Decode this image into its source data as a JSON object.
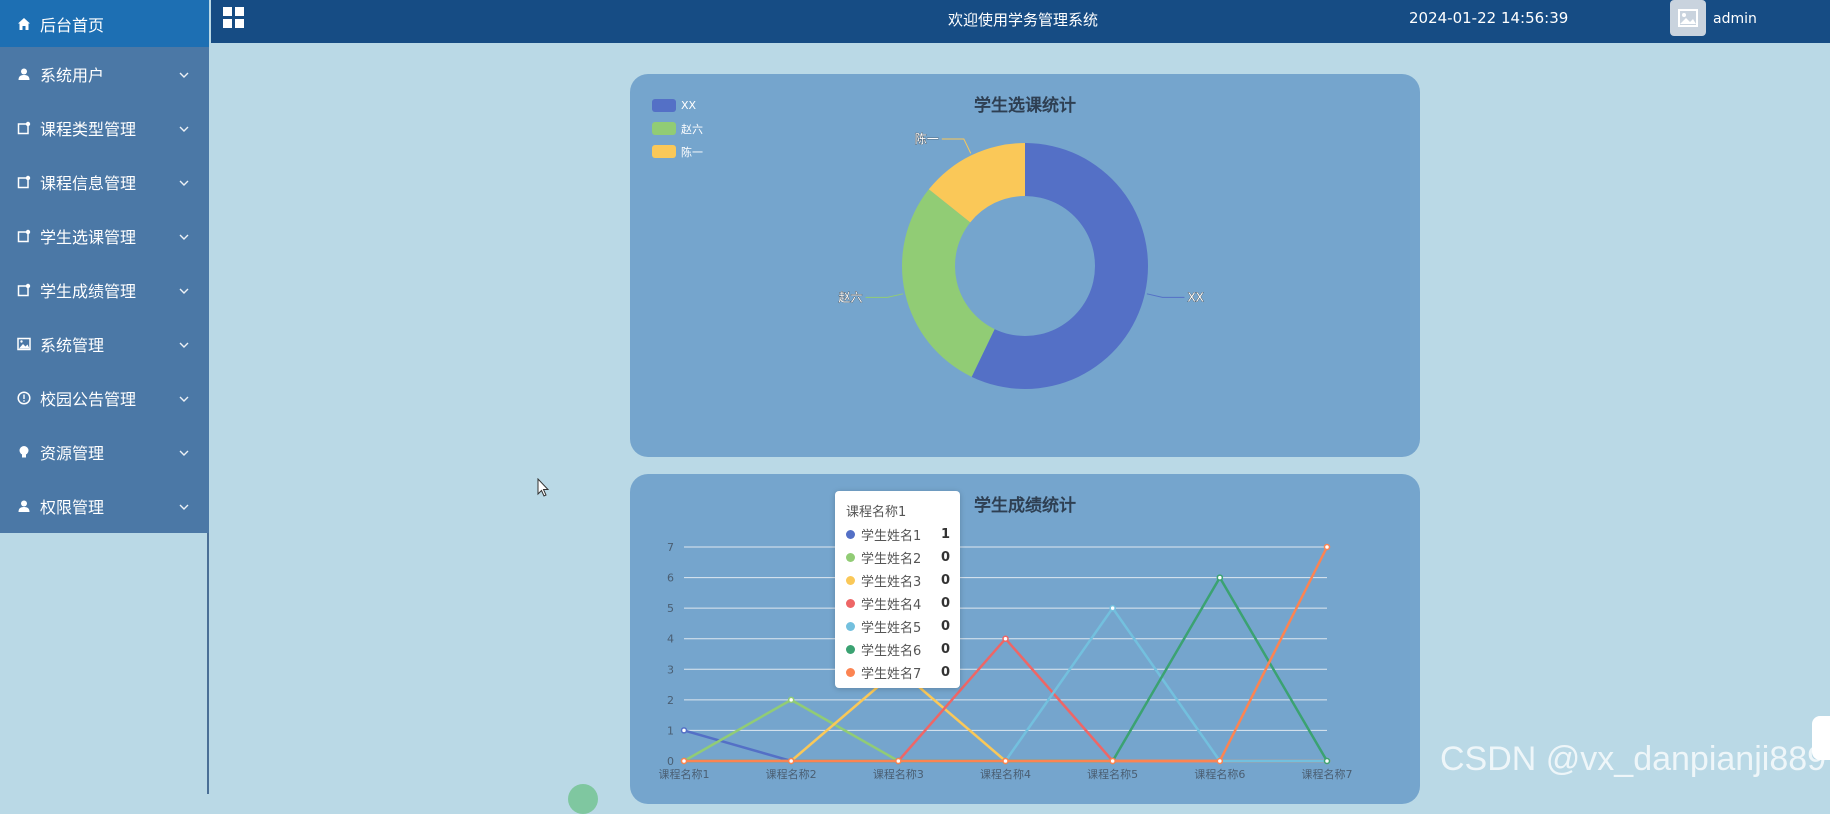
{
  "sidebar": {
    "items": [
      {
        "label": "后台首页",
        "icon": "home-icon",
        "active": true
      },
      {
        "label": "系统用户",
        "icon": "user-icon"
      },
      {
        "label": "课程类型管理",
        "icon": "edit-icon"
      },
      {
        "label": "课程信息管理",
        "icon": "edit-icon"
      },
      {
        "label": "学生选课管理",
        "icon": "edit-icon"
      },
      {
        "label": "学生成绩管理",
        "icon": "edit-icon"
      },
      {
        "label": "系统管理",
        "icon": "image-icon"
      },
      {
        "label": "校园公告管理",
        "icon": "info-icon"
      },
      {
        "label": "资源管理",
        "icon": "bulb-icon"
      },
      {
        "label": "权限管理",
        "icon": "user-icon"
      }
    ]
  },
  "header": {
    "title": "欢迎使用学务管理系统",
    "datetime": "2024-01-22 14:56:39",
    "username": "admin"
  },
  "colors": {
    "series": [
      "#5470c6",
      "#91cc75",
      "#fac858",
      "#ee6666",
      "#73c0de",
      "#3ba272",
      "#fc8452"
    ]
  },
  "chart_data": [
    {
      "type": "pie",
      "title": "学生选课统计",
      "categories": [
        "XX",
        "赵六",
        "陈一"
      ],
      "values": [
        4,
        2,
        1
      ],
      "legend": "top-left",
      "donut": true
    },
    {
      "type": "line",
      "title": "学生成绩统计",
      "x": [
        "课程名称1",
        "课程名称2",
        "课程名称3",
        "课程名称4",
        "课程名称5",
        "课程名称6",
        "课程名称7"
      ],
      "ylim": [
        0,
        7
      ],
      "yticks": [
        0,
        1,
        2,
        3,
        4,
        5,
        6,
        7
      ],
      "series": [
        {
          "name": "学生姓名1",
          "values": [
            1,
            0,
            0,
            0,
            0,
            0,
            0
          ]
        },
        {
          "name": "学生姓名2",
          "values": [
            0,
            2,
            0,
            0,
            0,
            0,
            0
          ]
        },
        {
          "name": "学生姓名3",
          "values": [
            0,
            0,
            3,
            0,
            0,
            0,
            0
          ]
        },
        {
          "name": "学生姓名4",
          "values": [
            0,
            0,
            0,
            4,
            0,
            0,
            0
          ]
        },
        {
          "name": "学生姓名5",
          "values": [
            0,
            0,
            0,
            0,
            5,
            0,
            0
          ]
        },
        {
          "name": "学生姓名6",
          "values": [
            0,
            0,
            0,
            0,
            0,
            6,
            0
          ]
        },
        {
          "name": "学生姓名7",
          "values": [
            0,
            0,
            0,
            0,
            0,
            0,
            7
          ]
        }
      ],
      "grid": true
    }
  ],
  "tooltip": {
    "title": "课程名称1",
    "rows": [
      {
        "name": "学生姓名1",
        "value": "1"
      },
      {
        "name": "学生姓名2",
        "value": "0"
      },
      {
        "name": "学生姓名3",
        "value": "0"
      },
      {
        "name": "学生姓名4",
        "value": "0"
      },
      {
        "name": "学生姓名5",
        "value": "0"
      },
      {
        "name": "学生姓名6",
        "value": "0"
      },
      {
        "name": "学生姓名7",
        "value": "0"
      }
    ]
  },
  "watermark": "CSDN @vx_danpianji889"
}
